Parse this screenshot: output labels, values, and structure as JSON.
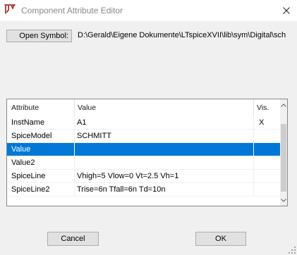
{
  "window": {
    "title": "Component Attribute Editor",
    "icons": {
      "app": "ltspice-app-icon",
      "close": "close-icon"
    }
  },
  "symbol": {
    "button_label": "Open Symbol:",
    "path": "D:\\Gerald\\Eigene Dokumente\\LTspiceXVII\\lib\\sym\\Digital\\sch"
  },
  "table": {
    "headers": {
      "attribute": "Attribute",
      "value": "Value",
      "vis": "Vis."
    },
    "rows": [
      {
        "attribute": "InstName",
        "value": "A1",
        "vis": "X"
      },
      {
        "attribute": "SpiceModel",
        "value": "SCHMITT",
        "vis": ""
      },
      {
        "attribute": "Value",
        "value": "",
        "vis": ""
      },
      {
        "attribute": "Value2",
        "value": "",
        "vis": ""
      },
      {
        "attribute": "SpiceLine",
        "value": "Vhigh=5 Vlow=0 Vt=2.5 Vh=1",
        "vis": ""
      },
      {
        "attribute": "SpiceLine2",
        "value": "Trise=6n Tfall=6n Td=10n",
        "vis": ""
      }
    ],
    "selected_row": "Value"
  },
  "buttons": {
    "cancel": "Cancel",
    "ok": "OK"
  },
  "colors": {
    "selection": "#0078d7",
    "dialog_background": "#f0f0f0",
    "button_face": "#e1e1e1"
  }
}
